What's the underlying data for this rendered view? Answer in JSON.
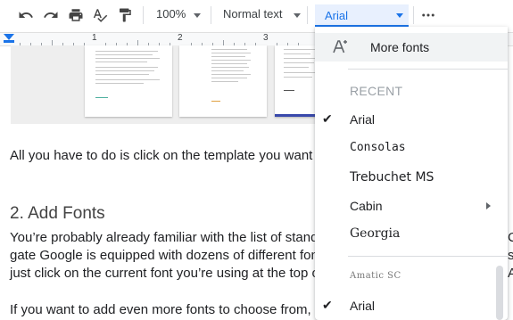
{
  "toolbar": {
    "zoom": "100%",
    "style": "Normal text",
    "font": "Arial",
    "icons": [
      "undo-icon",
      "redo-icon",
      "print-icon",
      "spellcheck-icon",
      "paint-format-icon",
      "more-icon"
    ]
  },
  "ruler": {
    "numbers": [
      "1",
      "2",
      "3"
    ]
  },
  "document": {
    "line1": "All you have to do is click on the template you want to",
    "heading": "2. Add Fonts",
    "para_line1": "You’re probably already familiar with the list of standa",
    "para_line2": "gate Google is equipped with dozens of different fonts",
    "para_line3": "just click on the current font you’re using at the top of",
    "para_line4": "If you want to add even more fonts to choose from, th",
    "edge_chars": [
      "C",
      "s",
      "A"
    ]
  },
  "font_menu": {
    "more_fonts": "More fonts",
    "recent_header": "RECENT",
    "recent": [
      {
        "name": "Arial",
        "checked": true
      },
      {
        "name": "Consolas",
        "checked": false
      },
      {
        "name": "Trebuchet MS",
        "checked": false
      },
      {
        "name": "Cabin",
        "checked": false,
        "submenu": true
      },
      {
        "name": "Georgia",
        "checked": false
      }
    ],
    "all": [
      {
        "name": "Amatic SC",
        "checked": false
      },
      {
        "name": "Arial",
        "checked": true
      }
    ]
  },
  "colors": {
    "accent": "#1a73e8",
    "menu_hover": "#f1f3f4"
  }
}
